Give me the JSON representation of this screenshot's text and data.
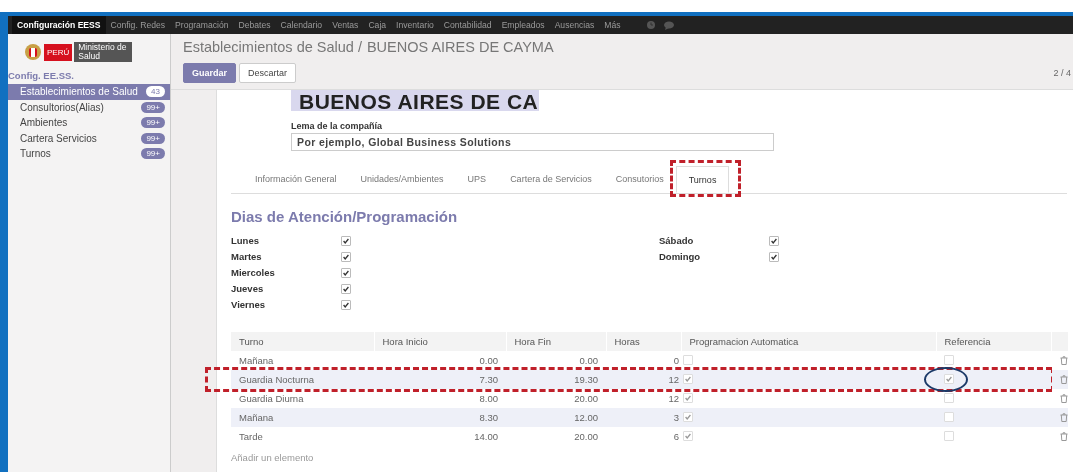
{
  "navbar": {
    "menu": [
      {
        "label": "Configuración EESS",
        "selected": true
      },
      {
        "label": "Config. Redes",
        "selected": false
      },
      {
        "label": "Programación",
        "selected": false
      },
      {
        "label": "Debates",
        "selected": false
      },
      {
        "label": "Calendario",
        "selected": false
      },
      {
        "label": "Ventas",
        "selected": false
      },
      {
        "label": "Caja",
        "selected": false
      },
      {
        "label": "Inventario",
        "selected": false
      },
      {
        "label": "Contabilidad",
        "selected": false
      },
      {
        "label": "Empleados",
        "selected": false
      },
      {
        "label": "Ausencias",
        "selected": false
      },
      {
        "label": "Más",
        "selected": false
      }
    ]
  },
  "logo": {
    "country": "PERÚ",
    "ministry": "Ministerio de Salud"
  },
  "sidebar": {
    "section": "Config. EE.SS.",
    "items": [
      {
        "label": "Establecimientos de Salud",
        "badge": "43",
        "selected": true
      },
      {
        "label": "Consultorios(Alias)",
        "badge": "99+",
        "selected": false
      },
      {
        "label": "Ambientes",
        "badge": "99+",
        "selected": false
      },
      {
        "label": "Cartera Servicios",
        "badge": "99+",
        "selected": false
      },
      {
        "label": "Turnos",
        "badge": "99+",
        "selected": false
      }
    ]
  },
  "control_panel": {
    "breadcrumb": "Establecimientos de Salud /",
    "record": "BUENOS AIRES DE CAYMA",
    "buttons": [
      {
        "label": "Guardar",
        "kind": "primary"
      },
      {
        "label": "Descartar",
        "kind": "secondary"
      }
    ],
    "pager": "2 / 4"
  },
  "form": {
    "name": "BUENOS AIRES DE CA",
    "slogan_label": "Lema de la compañía",
    "slogan": {
      "placeholder": "Por ejemplo, Global Business Solutions"
    },
    "tabs": [
      {
        "label": "Información General",
        "selected": false,
        "highlighted": false
      },
      {
        "label": "Unidades/Ambientes",
        "selected": false,
        "highlighted": false
      },
      {
        "label": "UPS",
        "selected": false,
        "highlighted": false
      },
      {
        "label": "Cartera de Servicios",
        "selected": false,
        "highlighted": false
      },
      {
        "label": "Consutorios",
        "selected": false,
        "highlighted": false
      },
      {
        "label": "Turnos",
        "selected": true,
        "highlighted": true
      }
    ],
    "section_title": "Dias de Atención/Programación",
    "days_left": [
      {
        "label": "Lunes",
        "checked": true
      },
      {
        "label": "Martes",
        "checked": true
      },
      {
        "label": "Miercoles",
        "checked": true
      },
      {
        "label": "Jueves",
        "checked": true
      },
      {
        "label": "Viernes",
        "checked": true
      }
    ],
    "days_right": [
      {
        "label": "Sábado",
        "checked": true
      },
      {
        "label": "Domingo",
        "checked": true
      }
    ],
    "table": {
      "columns": [
        "Turno",
        "Hora Inicio",
        "Hora Fin",
        "Horas",
        "Programacion Automatica",
        "Referencia"
      ],
      "rows": [
        {
          "turno": "Mañana",
          "inicio": "0.00",
          "fin": "0.00",
          "horas": "0",
          "automatica": false,
          "referencia": false,
          "highlighted": false,
          "circled": false
        },
        {
          "turno": "Guardia Nocturna",
          "inicio": "7.30",
          "fin": "19.30",
          "horas": "12",
          "automatica": true,
          "referencia": true,
          "highlighted": true,
          "circled": true
        },
        {
          "turno": "Guardia Diurna",
          "inicio": "8.00",
          "fin": "20.00",
          "horas": "12",
          "automatica": true,
          "referencia": false,
          "highlighted": false,
          "circled": false
        },
        {
          "turno": "Mañana",
          "inicio": "8.30",
          "fin": "12.00",
          "horas": "3",
          "automatica": true,
          "referencia": false,
          "highlighted": false,
          "circled": false
        },
        {
          "turno": "Tarde",
          "inicio": "14.00",
          "fin": "20.00",
          "horas": "6",
          "automatica": true,
          "referencia": false,
          "highlighted": false,
          "circled": false
        }
      ],
      "add_link": "Añadir un elemento"
    }
  }
}
